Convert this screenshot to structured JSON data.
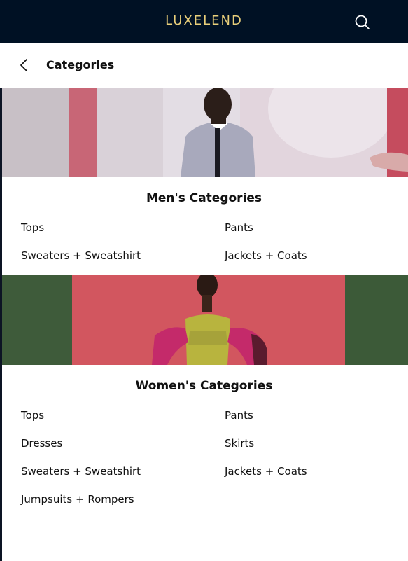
{
  "header": {
    "brand": "LUXELEND",
    "brand_color": "#e9cf7a",
    "background": "#001124",
    "search_icon": "search-icon"
  },
  "subheader": {
    "back_icon": "chevron-left-icon",
    "title": "Categories"
  },
  "men": {
    "title": "Men's Categories",
    "items": [
      "Tops",
      "Pants",
      "Sweaters + Sweatshirt",
      "Jackets + Coats"
    ]
  },
  "women": {
    "title": "Women's Categories",
    "items": [
      "Tops",
      "Pants",
      "Dresses",
      "Skirts",
      "Sweaters + Sweatshirt",
      "Jackets + Coats",
      "Jumpsuits + Rompers"
    ]
  }
}
